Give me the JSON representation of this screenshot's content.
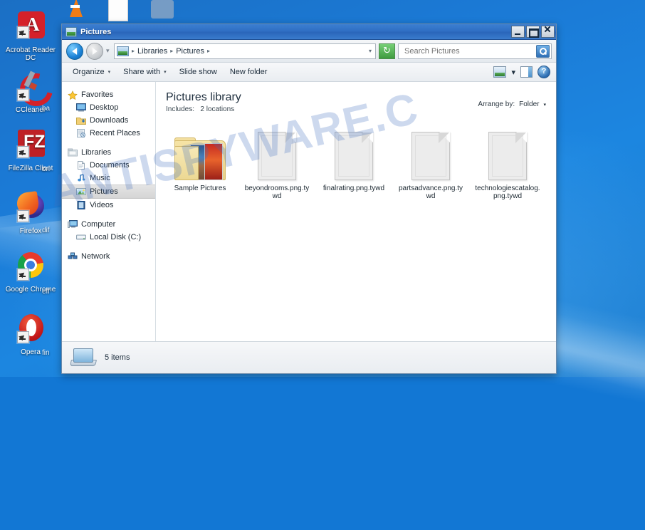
{
  "desktop": {
    "icons": [
      {
        "name": "acrobat-reader",
        "label": "Acrobat Reader DC"
      },
      {
        "name": "ccleaner",
        "label": "CCleaner"
      },
      {
        "name": "filezilla",
        "label": "FileZilla Client"
      },
      {
        "name": "firefox",
        "label": "Firefox"
      },
      {
        "name": "google-chrome",
        "label": "Google Chrome"
      },
      {
        "name": "opera",
        "label": "Opera"
      }
    ],
    "partial_labels": [
      "ba",
      "bri",
      "dif",
      "eff",
      "fin"
    ],
    "top_icons": [
      "vlc-cone",
      "document",
      "shield"
    ]
  },
  "watermark": {
    "text": "ANTISPYWARE.C",
    "color": "#3c6ebe"
  },
  "window": {
    "title": "Pictures",
    "icon": "pictures-folder-icon",
    "buttons": {
      "minimize": "Minimize",
      "maximize": "Maximize",
      "close": "Close"
    }
  },
  "navbar": {
    "back": "Back",
    "forward": "Forward",
    "recent_caret": "▾",
    "address": {
      "icon": "library-icon",
      "crumbs": [
        "Libraries",
        "Pictures"
      ],
      "separator": "▸",
      "dropdown": "▾"
    },
    "refresh": "↻",
    "search": {
      "placeholder": "Search Pictures",
      "value": "",
      "icon": "search-icon"
    }
  },
  "commandbar": {
    "items": [
      {
        "label": "Organize",
        "caret": "▾"
      },
      {
        "label": "Share with",
        "caret": "▾"
      },
      {
        "label": "Slide show",
        "caret": ""
      },
      {
        "label": "New folder",
        "caret": ""
      }
    ],
    "right": {
      "view_icon": "change-view-icon",
      "view_caret": "▾",
      "preview_pane_icon": "preview-pane-icon",
      "help_icon": "help-icon",
      "help_glyph": "?"
    }
  },
  "navpane": {
    "groups": [
      {
        "header": {
          "label": "Favorites",
          "icon": "star-icon"
        },
        "items": [
          {
            "label": "Desktop",
            "icon": "desktop-icon"
          },
          {
            "label": "Downloads",
            "icon": "downloads-icon"
          },
          {
            "label": "Recent Places",
            "icon": "recent-places-icon"
          }
        ]
      },
      {
        "header": {
          "label": "Libraries",
          "icon": "libraries-icon"
        },
        "items": [
          {
            "label": "Documents",
            "icon": "documents-icon"
          },
          {
            "label": "Music",
            "icon": "music-icon"
          },
          {
            "label": "Pictures",
            "icon": "pictures-icon",
            "selected": true
          },
          {
            "label": "Videos",
            "icon": "videos-icon"
          }
        ]
      },
      {
        "header": {
          "label": "Computer",
          "icon": "computer-icon"
        },
        "items": [
          {
            "label": "Local Disk (C:)",
            "icon": "hard-disk-icon"
          }
        ]
      },
      {
        "header": {
          "label": "Network",
          "icon": "network-icon"
        },
        "items": []
      }
    ]
  },
  "library": {
    "title": "Pictures library",
    "includes_label": "Includes:",
    "includes_value": "2 locations",
    "arrange_label": "Arrange by:",
    "arrange_value": "Folder",
    "arrange_caret": "▾"
  },
  "files": [
    {
      "label": "Sample Pictures",
      "type": "folder"
    },
    {
      "label": "beyondrooms.png.tywd",
      "type": "file"
    },
    {
      "label": "finalrating.png.tywd",
      "type": "file"
    },
    {
      "label": "partsadvance.png.tywd",
      "type": "file"
    },
    {
      "label": "technologiescatalog.png.tywd",
      "type": "file"
    }
  ],
  "statusbar": {
    "icon": "computer-status-icon",
    "text": "5 items"
  }
}
